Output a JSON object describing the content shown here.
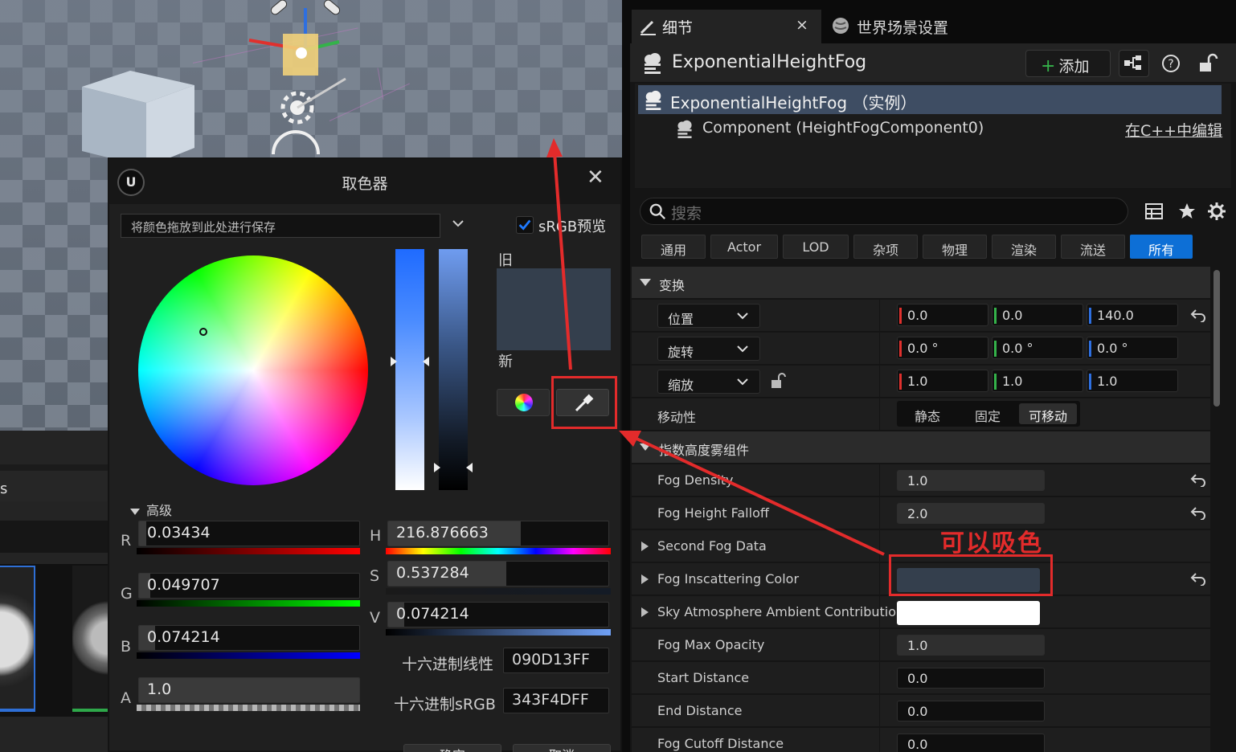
{
  "viewport": {},
  "content_browser": {
    "partial_label": "s"
  },
  "picker": {
    "title": "取色器",
    "theme_bar_text": "将颜色拖放到此处进行保存",
    "srgb_label": "sRGB预览",
    "old_label": "旧",
    "new_label": "新",
    "advanced_label": "高级",
    "swatch_color": "#343F4D",
    "channels": {
      "r": {
        "label": "R",
        "value": "0.03434",
        "fraction": 0.03434
      },
      "g": {
        "label": "G",
        "value": "0.049707",
        "fraction": 0.049707
      },
      "b": {
        "label": "B",
        "value": "0.074214",
        "fraction": 0.074214
      },
      "a": {
        "label": "A",
        "value": "1.0",
        "fraction": 1.0
      },
      "h": {
        "label": "H",
        "value": "216.876663",
        "fraction": 0.6024
      },
      "s": {
        "label": "S",
        "value": "0.537284",
        "fraction": 0.537284
      },
      "v": {
        "label": "V",
        "value": "0.074214",
        "fraction": 0.074214
      }
    },
    "hex_linear_label": "十六进制线性",
    "hex_linear_value": "090D13FF",
    "hex_srgb_label": "十六进制sRGB",
    "hex_srgb_value": "343F4DFF",
    "ok_label": "确定",
    "cancel_label": "取消"
  },
  "details": {
    "tab_details": "细节",
    "tab_close": "×",
    "tab_world": "世界场景设置",
    "actor_name": "ExponentialHeightFog",
    "add_label": "添加",
    "tree": {
      "instance": "ExponentialHeightFog （实例）",
      "component": "Component (HeightFogComponent0)",
      "edit_cpp": "在C++中编辑"
    },
    "search_placeholder": "搜索",
    "filters": [
      "通用",
      "Actor",
      "LOD",
      "杂项",
      "物理",
      "渲染",
      "流送",
      "所有"
    ],
    "active_filter": "所有",
    "transform": {
      "section": "变换",
      "location": {
        "label": "位置",
        "x": "0.0",
        "y": "0.0",
        "z": "140.0"
      },
      "rotation": {
        "label": "旋转",
        "x": "0.0 °",
        "y": "0.0 °",
        "z": "0.0 °"
      },
      "scale": {
        "label": "缩放",
        "x": "1.0",
        "y": "1.0",
        "z": "1.0"
      },
      "mobility_label": "移动性",
      "mobility_options": [
        "静态",
        "固定",
        "可移动"
      ],
      "mobility_selected": "可移动"
    },
    "fog_section": "指数高度雾组件",
    "properties": [
      {
        "name": "Fog Density",
        "value": "1.0"
      },
      {
        "name": "Fog Height Falloff",
        "value": "2.0"
      },
      {
        "name": "Second Fog Data",
        "value": ""
      },
      {
        "name": "Fog Inscattering Color",
        "value": ""
      },
      {
        "name": "Sky Atmosphere Ambient Contributio...",
        "value": ""
      },
      {
        "name": "Fog Max Opacity",
        "value": "1.0"
      },
      {
        "name": "Start Distance",
        "value": "0.0"
      },
      {
        "name": "End Distance",
        "value": "0.0"
      },
      {
        "name": "Fog Cutoff Distance",
        "value": "0.0"
      }
    ],
    "inscattering_color": "#343F4D",
    "sky_ambient_color": "#FFFFFF"
  },
  "annotation": {
    "text": "可以吸色",
    "color": "#E32B2B"
  },
  "colors": {
    "accent": "#0D6FD6",
    "selected_row": "#3E4D63",
    "axis_x": "#E0302D",
    "axis_y": "#34B24A",
    "axis_z": "#2E6FE0"
  }
}
